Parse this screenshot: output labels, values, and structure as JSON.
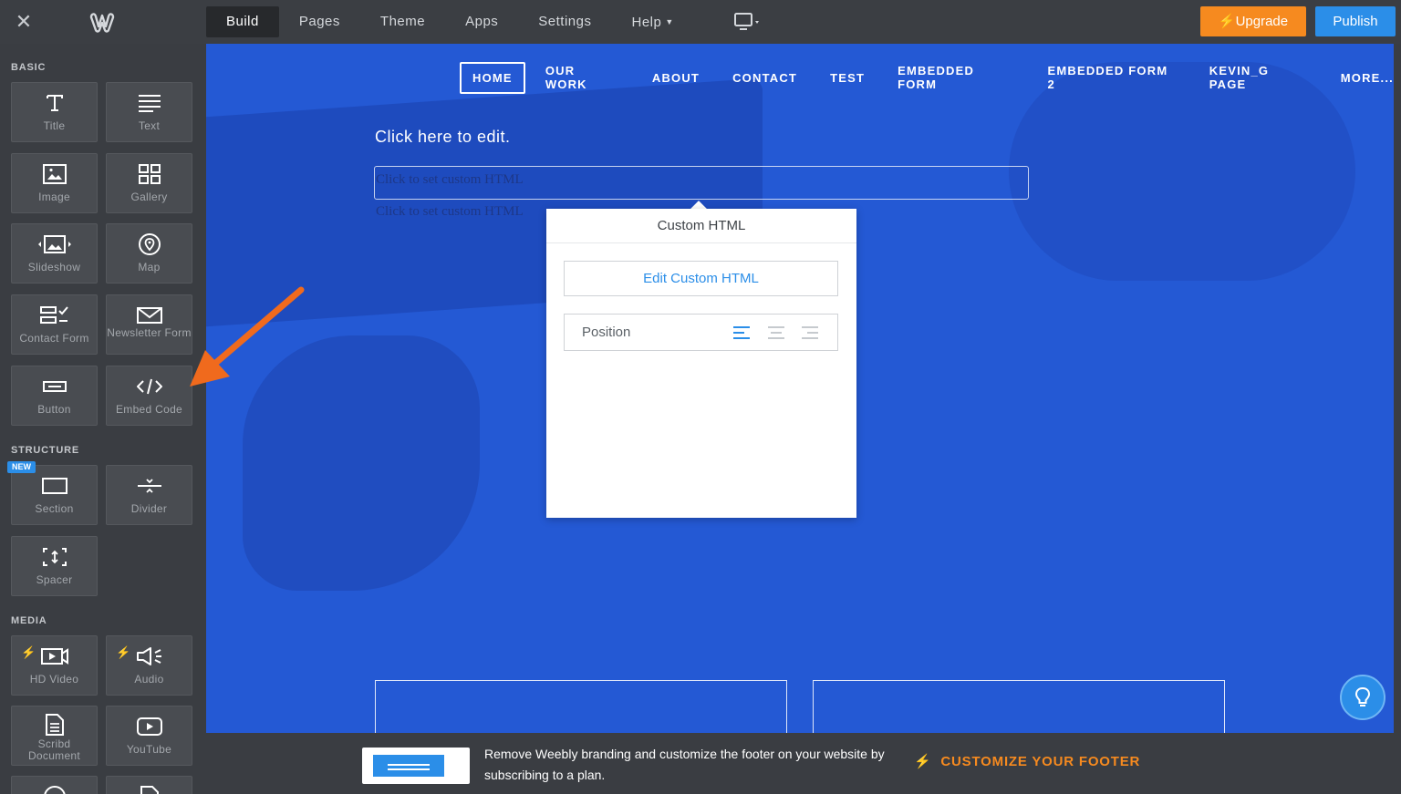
{
  "topbar": {
    "nav": [
      {
        "label": "Build",
        "active": true
      },
      {
        "label": "Pages"
      },
      {
        "label": "Theme"
      },
      {
        "label": "Apps"
      },
      {
        "label": "Settings"
      },
      {
        "label": "Help",
        "dropdown": true
      }
    ],
    "upgrade_label": "Upgrade",
    "publish_label": "Publish"
  },
  "sidebar": {
    "basic_label": "BASIC",
    "structure_label": "STRUCTURE",
    "media_label": "MEDIA",
    "new_badge": "NEW",
    "basic": [
      {
        "label": "Title",
        "icon": "title-icon"
      },
      {
        "label": "Text",
        "icon": "text-icon"
      },
      {
        "label": "Image",
        "icon": "image-icon"
      },
      {
        "label": "Gallery",
        "icon": "gallery-icon"
      },
      {
        "label": "Slideshow",
        "icon": "slideshow-icon"
      },
      {
        "label": "Map",
        "icon": "map-pin-icon"
      },
      {
        "label": "Contact Form",
        "icon": "contact-form-icon"
      },
      {
        "label": "Newsletter Form",
        "icon": "envelope-icon"
      },
      {
        "label": "Button",
        "icon": "button-icon"
      },
      {
        "label": "Embed Code",
        "icon": "code-icon"
      }
    ],
    "structure": [
      {
        "label": "Section",
        "icon": "section-icon"
      },
      {
        "label": "Divider",
        "icon": "divider-icon"
      },
      {
        "label": "Spacer",
        "icon": "spacer-icon"
      }
    ],
    "media": [
      {
        "label": "HD Video",
        "icon": "video-icon"
      },
      {
        "label": "Audio",
        "icon": "audio-icon"
      },
      {
        "label": "Scribd Document",
        "icon": "document-icon"
      },
      {
        "label": "YouTube",
        "icon": "youtube-icon"
      }
    ]
  },
  "site": {
    "nav": [
      "HOME",
      "OUR WORK",
      "ABOUT",
      "CONTACT",
      "TEST",
      "EMBEDDED FORM",
      "EMBEDDED FORM 2",
      "KEVIN_G PAGE",
      "MORE..."
    ],
    "click_edit": "Click here to edit.",
    "ghost_text": "Click to set custom HTML"
  },
  "popup": {
    "title": "Custom HTML",
    "edit_button": "Edit Custom HTML",
    "position_label": "Position"
  },
  "promo": {
    "text": "Remove Weebly branding and customize the footer on your website by subscribing to a plan.",
    "cta": "CUSTOMIZE YOUR FOOTER"
  },
  "colors": {
    "accent_orange": "#f68a1f",
    "accent_blue": "#2b8ee8",
    "canvas_blue": "#2459d4",
    "chrome_dark": "#3a3d42"
  }
}
